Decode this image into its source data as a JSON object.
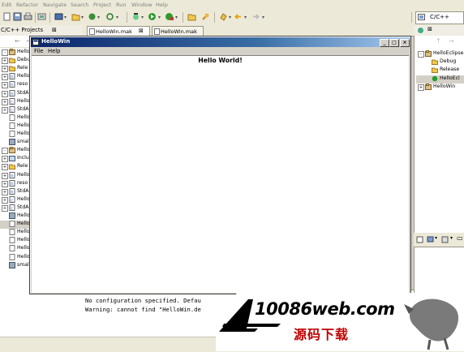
{
  "menubar": {
    "items": [
      "Edit",
      "Refactor",
      "Navigate",
      "Search",
      "Project",
      "Run",
      "Window",
      "Help"
    ]
  },
  "perspective": {
    "label": "C/C++"
  },
  "projects_view": {
    "tab_label": "C/C++ Projects",
    "tree": [
      {
        "label": "HelloEclipse",
        "level": 0,
        "expander": "-",
        "icon": "project-icon"
      },
      {
        "label": "Debug",
        "level": 1,
        "expander": "+",
        "icon": "folder-icon"
      },
      {
        "label": "Rele",
        "level": 1,
        "expander": "+",
        "icon": "folder-icon"
      },
      {
        "label": "Hello",
        "level": 1,
        "expander": "+",
        "icon": "header-file-icon"
      },
      {
        "label": "reso",
        "level": 1,
        "expander": "+",
        "icon": "header-file-icon"
      },
      {
        "label": "StdA",
        "level": 1,
        "expander": "+",
        "icon": "header-file-icon"
      },
      {
        "label": "Hello",
        "level": 1,
        "expander": "+",
        "icon": "source-file-icon"
      },
      {
        "label": "StdA",
        "level": 1,
        "expander": "+",
        "icon": "source-file-icon"
      },
      {
        "label": "Hello",
        "level": 1,
        "expander": "",
        "icon": "file-icon"
      },
      {
        "label": "Hello",
        "level": 1,
        "expander": "",
        "icon": "file-icon"
      },
      {
        "label": "Hello",
        "level": 1,
        "expander": "",
        "icon": "file-icon"
      },
      {
        "label": "smal",
        "level": 1,
        "expander": "",
        "icon": "image-file-icon"
      },
      {
        "label": "HelloWin",
        "level": 0,
        "expander": "-",
        "icon": "project-icon"
      },
      {
        "label": "Inclu",
        "level": 1,
        "expander": "+",
        "icon": "includes-icon"
      },
      {
        "label": "Rele",
        "level": 1,
        "expander": "+",
        "icon": "folder-icon"
      },
      {
        "label": "Hello",
        "level": 1,
        "expander": "+",
        "icon": "header-file-icon"
      },
      {
        "label": "reso",
        "level": 1,
        "expander": "+",
        "icon": "header-file-icon"
      },
      {
        "label": "StdA",
        "level": 1,
        "expander": "+",
        "icon": "header-file-icon"
      },
      {
        "label": "Hello",
        "level": 1,
        "expander": "+",
        "icon": "source-file-icon"
      },
      {
        "label": "StdA",
        "level": 1,
        "expander": "+",
        "icon": "source-file-icon"
      },
      {
        "label": "Hello",
        "level": 1,
        "expander": "",
        "icon": "image-file-icon"
      },
      {
        "label": "Hello",
        "level": 1,
        "expander": "",
        "icon": "file-icon",
        "selected": true
      },
      {
        "label": "Hello",
        "level": 1,
        "expander": "",
        "icon": "file-icon"
      },
      {
        "label": "Hello",
        "level": 1,
        "expander": "",
        "icon": "file-icon"
      },
      {
        "label": "Hello",
        "level": 1,
        "expander": "",
        "icon": "file-icon"
      },
      {
        "label": "Hello",
        "level": 1,
        "expander": "",
        "icon": "file-icon"
      },
      {
        "label": "smal",
        "level": 1,
        "expander": "",
        "icon": "image-file-icon"
      }
    ]
  },
  "editor_tabs": [
    {
      "label": "HelloWin.mak",
      "active": true,
      "close": "⊠"
    },
    {
      "label": "HelloWin.mak",
      "active": false
    }
  ],
  "outline_view": {
    "tree": [
      {
        "label": "HelloEclipse",
        "level": 0,
        "expander": "-",
        "icon": "project-icon"
      },
      {
        "label": "Debug",
        "level": 1,
        "expander": "",
        "icon": "folder-icon"
      },
      {
        "label": "Release",
        "level": 1,
        "expander": "",
        "icon": "folder-icon"
      },
      {
        "label": "HelloEcl",
        "level": 1,
        "expander": "",
        "icon": "config-icon",
        "selected": true
      },
      {
        "label": "HelloWin",
        "level": 0,
        "expander": "+",
        "icon": "project-icon"
      }
    ]
  },
  "console": {
    "lines": [
      "No configuration specified. Defau",
      "Warning: cannot find \"HelloWin.de"
    ]
  },
  "app_window": {
    "title": "HelloWin",
    "menu": [
      "File",
      "Help"
    ],
    "message": "Hello World!",
    "buttons": {
      "minimize": "_",
      "maximize": "□",
      "close": "×"
    }
  },
  "watermark": {
    "site": "10086web.com",
    "cn": "源码下载"
  },
  "colors": {
    "title_active": "#0a246a",
    "watermark_red": "#c00000"
  }
}
